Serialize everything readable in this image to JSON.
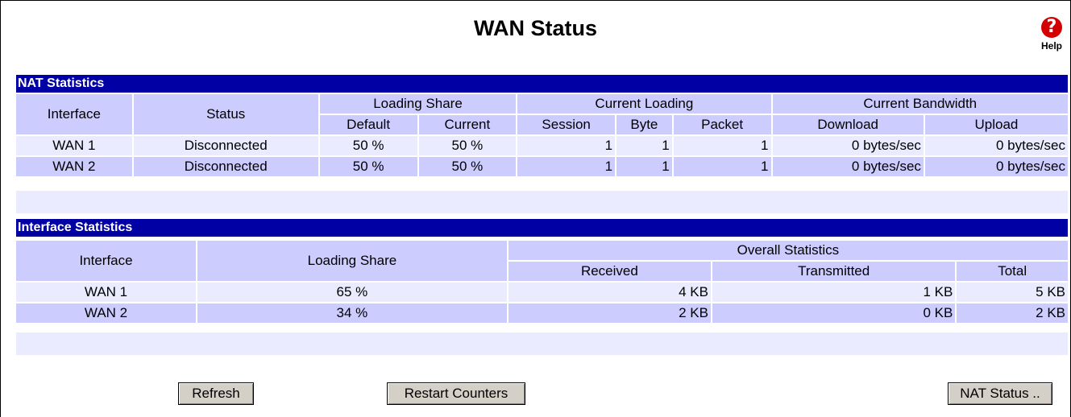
{
  "page": {
    "title": "WAN Status",
    "help_label": "Help",
    "help_glyph": "?"
  },
  "nat": {
    "section_title": "NAT Statistics",
    "headers": {
      "interface": "Interface",
      "status": "Status",
      "loading_share": "Loading Share",
      "current_loading": "Current Loading",
      "current_bandwidth": "Current Bandwidth",
      "default": "Default",
      "current": "Current",
      "session": "Session",
      "byte": "Byte",
      "packet": "Packet",
      "download": "Download",
      "upload": "Upload"
    },
    "rows": [
      {
        "interface": "WAN 1",
        "status": "Disconnected",
        "default": "50 %",
        "current": "50 %",
        "session": "1",
        "byte": "1",
        "packet": "1",
        "download": "0 bytes/sec",
        "upload": "0 bytes/sec"
      },
      {
        "interface": "WAN 2",
        "status": "Disconnected",
        "default": "50 %",
        "current": "50 %",
        "session": "1",
        "byte": "1",
        "packet": "1",
        "download": "0 bytes/sec",
        "upload": "0 bytes/sec"
      }
    ]
  },
  "iface": {
    "section_title": "Interface Statistics",
    "headers": {
      "interface": "Interface",
      "loading_share": "Loading Share",
      "overall": "Overall Statistics",
      "received": "Received",
      "transmitted": "Transmitted",
      "total": "Total"
    },
    "rows": [
      {
        "interface": "WAN 1",
        "loading_share": "65 %",
        "received": "4 KB",
        "transmitted": "1 KB",
        "total": "5 KB"
      },
      {
        "interface": "WAN 2",
        "loading_share": "34 %",
        "received": "2 KB",
        "transmitted": "0 KB",
        "total": "2 KB"
      }
    ]
  },
  "buttons": {
    "refresh": "Refresh",
    "restart": "Restart Counters",
    "nat_status": "NAT Status .."
  },
  "colors": {
    "section_bar": "#0000a4",
    "header_cell": "#ccccff",
    "row_light": "#ebebff",
    "help_icon": "#d40000"
  }
}
